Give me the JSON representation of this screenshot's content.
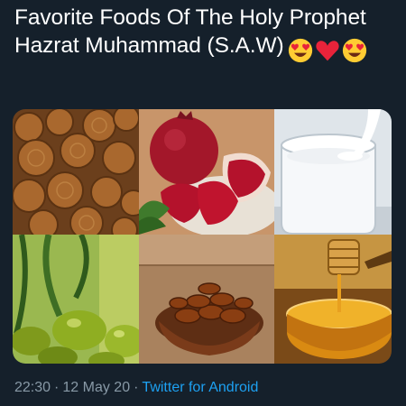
{
  "tweet": {
    "text": "Favorite Foods Of The Holy Prophet Hazrat Muhammad (S.A.W)",
    "emojis": [
      "heart-eyes-icon",
      "red-heart-icon",
      "heart-eyes-icon"
    ],
    "timestamp": "22:30",
    "separator": "·",
    "date": "12 May 20",
    "source": "Twitter for Android"
  },
  "media": {
    "cells": [
      "dried-figs",
      "pomegranate",
      "milk",
      "olives",
      "dates",
      "honey"
    ]
  },
  "colors": {
    "background": "#15202b",
    "text": "#ffffff",
    "meta": "#8899a6",
    "link": "#1da1f2"
  }
}
